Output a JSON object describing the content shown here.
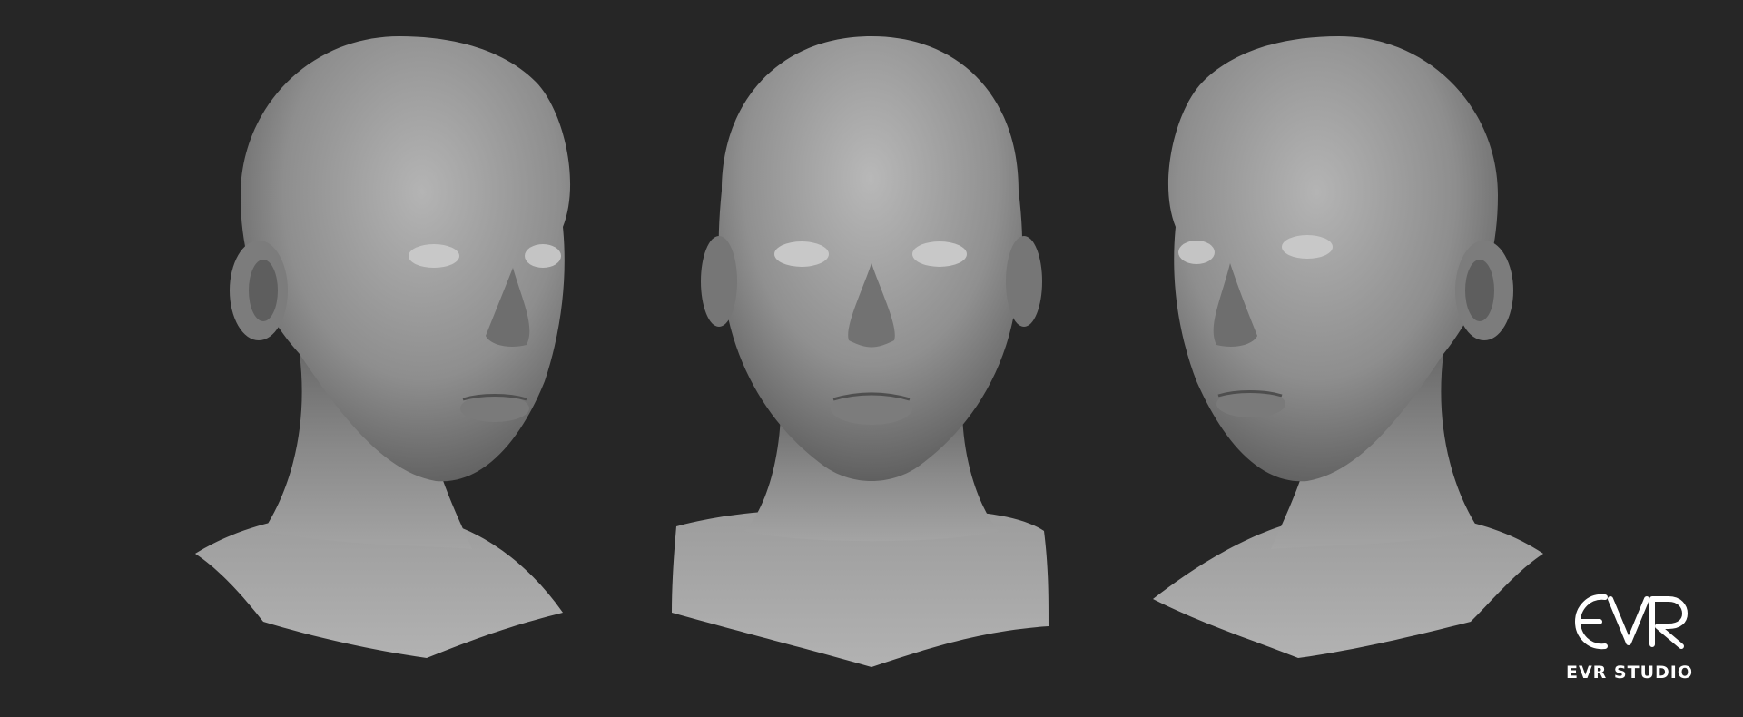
{
  "scene": {
    "description_colors": {
      "background": "#262626",
      "clay": "#9a9a9a"
    },
    "views": [
      {
        "id": "three-quarter-left"
      },
      {
        "id": "front"
      },
      {
        "id": "three-quarter-right"
      }
    ]
  },
  "watermark": {
    "logo_icon": "evr-logo-icon",
    "studio_name": "EVR STUDIO"
  }
}
